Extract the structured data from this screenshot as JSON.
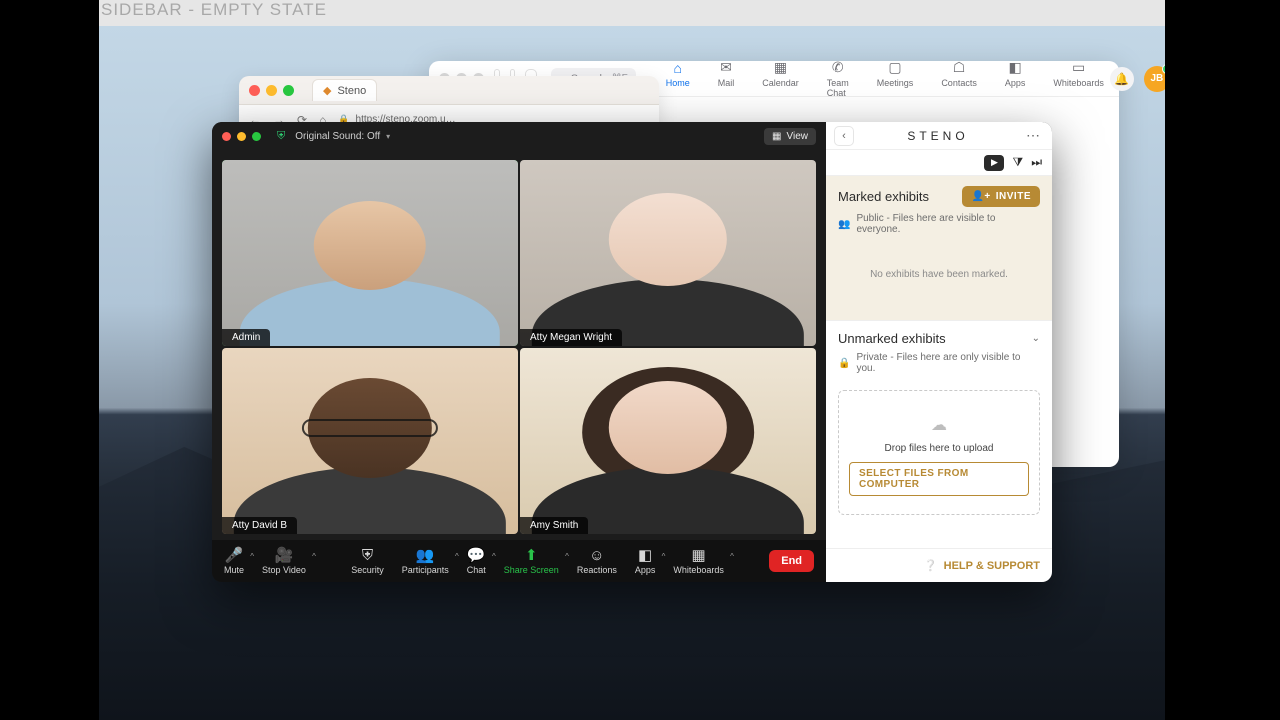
{
  "spec": {
    "title": "SIDEBAR - EMPTY STATE"
  },
  "zoom_app": {
    "search_placeholder": "Search",
    "search_shortcut": "⌘F",
    "tabs": [
      {
        "label": "Home"
      },
      {
        "label": "Mail"
      },
      {
        "label": "Calendar"
      },
      {
        "label": "Team Chat"
      },
      {
        "label": "Meetings"
      },
      {
        "label": "Contacts"
      },
      {
        "label": "Apps"
      },
      {
        "label": "Whiteboards"
      }
    ],
    "avatar_initials": "JB"
  },
  "safari": {
    "tab_title": "Steno",
    "url": "https://steno.zoom.u…"
  },
  "meeting": {
    "original_sound": "Original Sound: Off",
    "view_label": "View",
    "participants": [
      {
        "name": "Admin"
      },
      {
        "name": "Atty Megan Wright"
      },
      {
        "name": "Atty David B"
      },
      {
        "name": "Amy Smith"
      }
    ],
    "controls": [
      {
        "label": "Mute"
      },
      {
        "label": "Stop Video"
      },
      {
        "label": "Security"
      },
      {
        "label": "Participants"
      },
      {
        "label": "Chat"
      },
      {
        "label": "Share Screen"
      },
      {
        "label": "Reactions"
      },
      {
        "label": "Apps"
      },
      {
        "label": "Whiteboards"
      }
    ],
    "end_label": "End"
  },
  "sidebar": {
    "brand": "STENO",
    "marked": {
      "title": "Marked exhibits",
      "invite": "INVITE",
      "visibility": "Public - Files here are visible to everyone.",
      "empty": "No exhibits have been marked."
    },
    "unmarked": {
      "title": "Unmarked exhibits",
      "visibility": "Private - Files here are only visible to you.",
      "drop_hint": "Drop files here to upload",
      "select": "SELECT FILES FROM COMPUTER"
    },
    "support": "HELP & SUPPORT"
  }
}
